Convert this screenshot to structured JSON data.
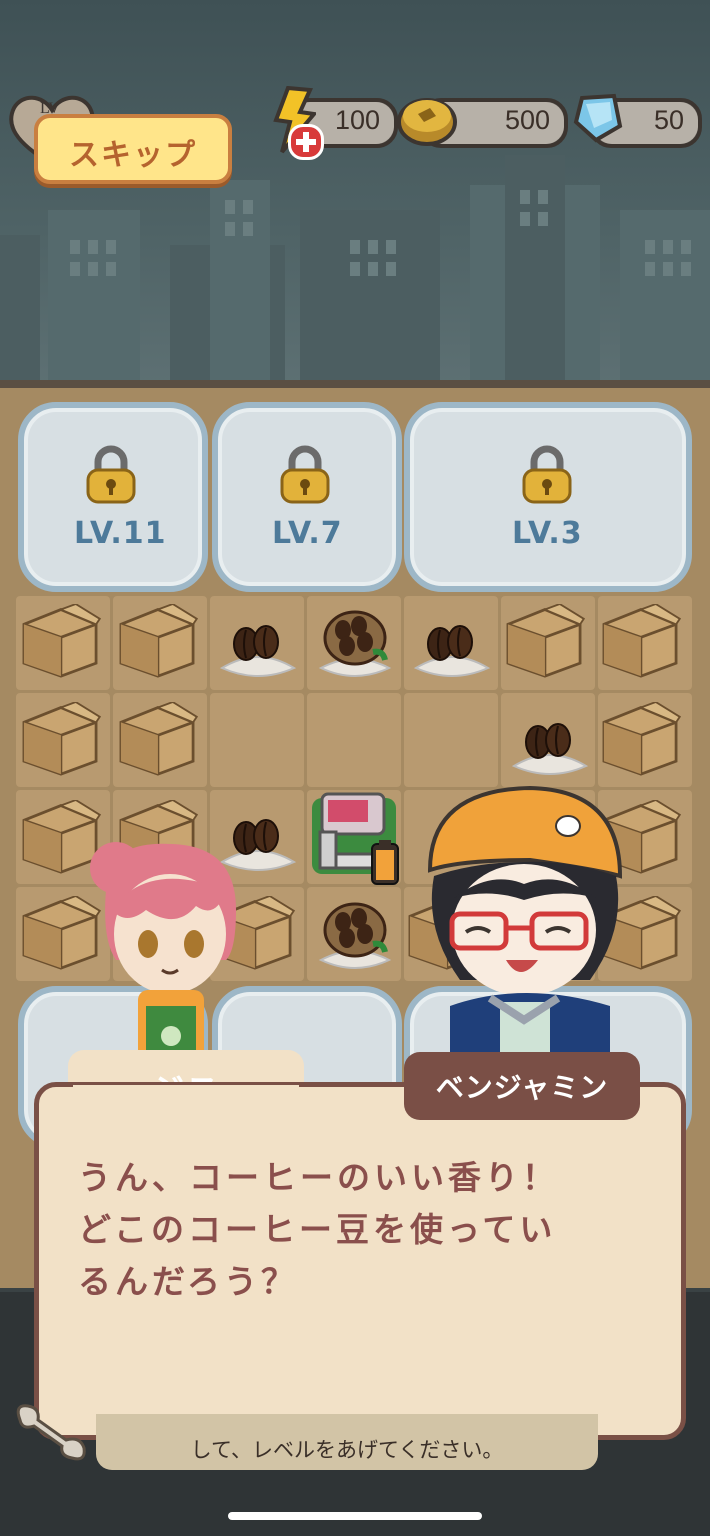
{
  "hud": {
    "level_badge": "LV",
    "energy": "100",
    "coins": "500",
    "gems": "50",
    "skip_label": "スキップ"
  },
  "locked_areas": [
    {
      "level": "LV.11"
    },
    {
      "level": "LV.7"
    },
    {
      "level": "LV.3"
    }
  ],
  "dialog": {
    "speaker_left": "ジス",
    "speaker_right": "ベンジャミン",
    "lines": [
      "うん、コーヒーのいい香り！",
      "どこのコーヒー豆を使ってい",
      "るんだろう？"
    ]
  },
  "hint": {
    "text": "して、レベルをあげてください。"
  },
  "colors": {
    "skip_bg": "#ffe58a",
    "dialog_bg": "#f2e1c7",
    "dialog_text": "#8a4f4c",
    "tab_active": "#7a4f46"
  }
}
